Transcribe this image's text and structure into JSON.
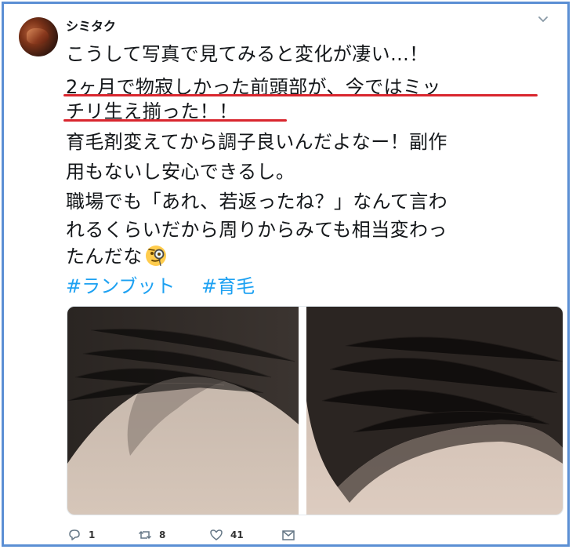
{
  "user": {
    "display_name": "シミタク"
  },
  "tweet": {
    "lines": [
      "こうして写真で見てみると変化が凄い...！",
      "2ヶ月で物寂しかった前頭部が、今ではミッ",
      "チリ生え揃った！！",
      "育毛剤変えてから調子良いんだよなー！副作",
      "用もないし安心できるし。",
      "職場でも「あれ、若返ったね？」なんて言わ",
      "れるくらいだから周りからみても相当変わっ",
      "たんだな"
    ],
    "emoji": "face-with-monocle",
    "hashtags": [
      "#ランブット",
      "#育毛"
    ],
    "highlight_color": "#d9262e"
  },
  "media": {
    "images": [
      "before-hairline-photo",
      "after-hairline-photo"
    ]
  },
  "actions": {
    "reply_count": "1",
    "retweet_count": "8",
    "like_count": "41"
  },
  "colors": {
    "frame": "#5b8fd4",
    "hashtag": "#1da1f2",
    "text": "#14171a"
  }
}
